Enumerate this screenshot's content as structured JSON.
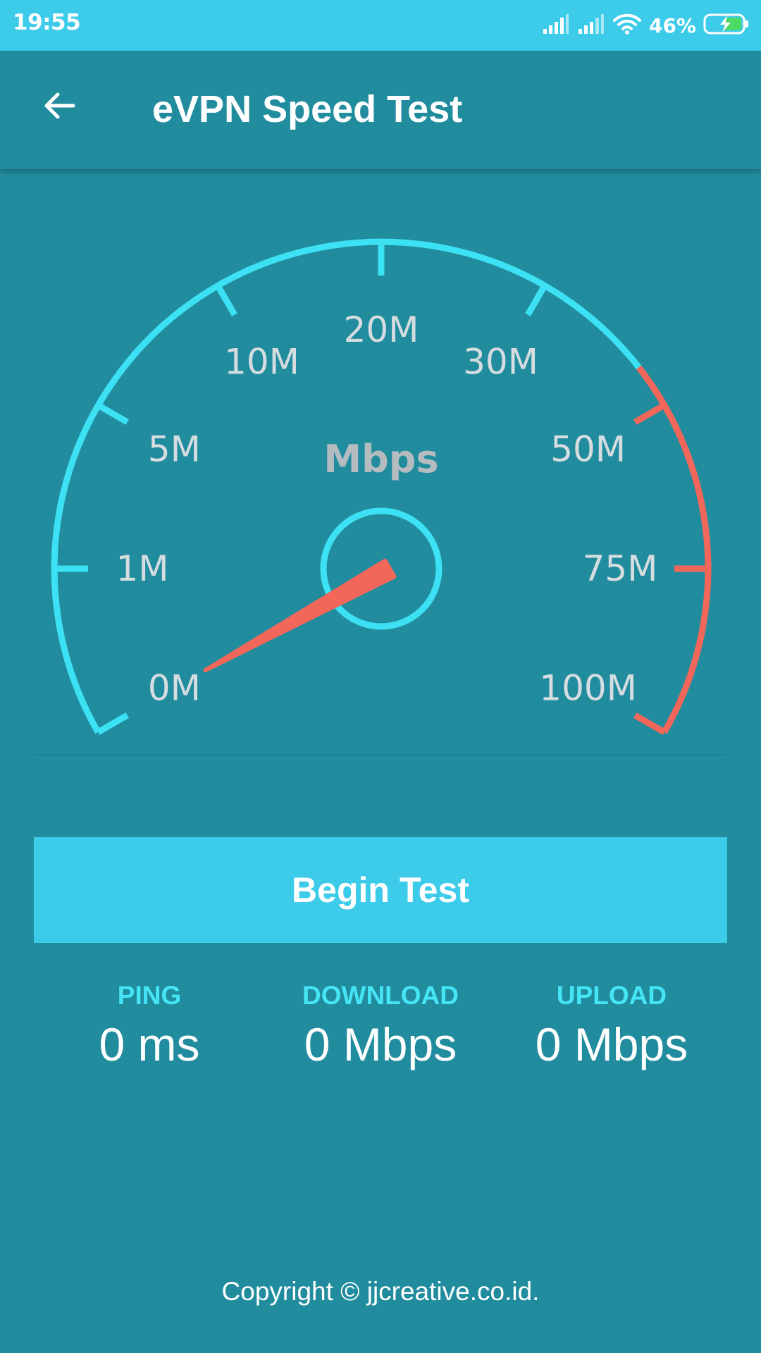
{
  "status_bar": {
    "time": "19:55",
    "battery_percent": "46%",
    "icons": [
      "signal-icon",
      "signal-icon",
      "wifi-icon",
      "battery-charging-icon"
    ]
  },
  "app_bar": {
    "back_icon": "arrow-left-icon",
    "title": "eVPN Speed Test"
  },
  "gauge": {
    "unit": "Mbps",
    "ticks": [
      "0M",
      "1M",
      "5M",
      "10M",
      "20M",
      "30M",
      "50M",
      "75M",
      "100M"
    ],
    "needle_value": "0M",
    "colors": {
      "normal": "#3DE1F4",
      "high": "#F2675A",
      "needle": "#F2675A"
    }
  },
  "actions": {
    "begin_label": "Begin Test"
  },
  "stats": [
    {
      "label": "PING",
      "value": "0 ms"
    },
    {
      "label": "DOWNLOAD",
      "value": "0 Mbps"
    },
    {
      "label": "UPLOAD",
      "value": "0 Mbps"
    }
  ],
  "footer": {
    "copyright": "Copyright © jjcreative.co.id."
  },
  "colors": {
    "background": "#218C9E",
    "status_bar": "#3DCBEA",
    "button": "#3DCBEA",
    "stat_label": "#45E5F6"
  }
}
